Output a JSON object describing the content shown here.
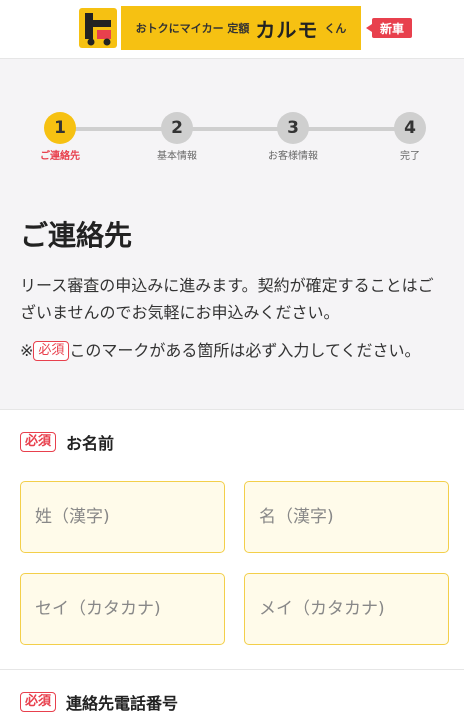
{
  "header": {
    "logo_small": "おトクにマイカー 定額",
    "logo_big": "カルモ",
    "logo_kun": "くん",
    "badge": "新車"
  },
  "steps": [
    {
      "number": "1",
      "label": "ご連絡先",
      "active": true
    },
    {
      "number": "2",
      "label": "基本情報",
      "active": false
    },
    {
      "number": "3",
      "label": "お客様情報",
      "active": false
    },
    {
      "number": "4",
      "label": "完了",
      "active": false
    }
  ],
  "page": {
    "title": "ご連絡先",
    "description": "リース審査の申込みに進みます。契約が確定することはございませんのでお気軽にお申込みください。",
    "note_prefix": "※",
    "required_badge": "必須",
    "note_suffix": "このマークがある箇所は必ず入力してください。"
  },
  "form": {
    "name_label": "お名前",
    "phone_label": "連絡先電話番号",
    "last_kanji_placeholder": "姓（漢字)",
    "first_kanji_placeholder": "名（漢字)",
    "last_kana_placeholder": "セイ（カタカナ)",
    "first_kana_placeholder": "メイ（カタカナ)"
  },
  "colors": {
    "accent": "#f6c112",
    "required": "#e8404d",
    "input_bg": "#fffbea"
  }
}
